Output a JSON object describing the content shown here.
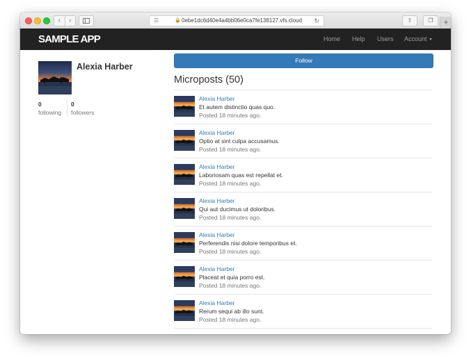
{
  "browser": {
    "url": "0ebe1dc6d40e4a4bb06e0ca7fe138127.vfs.cloud"
  },
  "header": {
    "logo": "SAMPLE APP",
    "nav": {
      "home": "Home",
      "help": "Help",
      "users": "Users",
      "account": "Account"
    }
  },
  "profile": {
    "name": "Alexia Harber",
    "following_count": "0",
    "following_label": "following",
    "followers_count": "0",
    "followers_label": "followers"
  },
  "follow_button": "Follow",
  "microposts": {
    "heading": "Microposts (50)",
    "items": [
      {
        "author": "Alexia Harber",
        "content": "Et autem distinctio quas quo.",
        "timestamp": "Posted 18 minutes ago."
      },
      {
        "author": "Alexia Harber",
        "content": "Optio at sint culpa accusamus.",
        "timestamp": "Posted 18 minutes ago."
      },
      {
        "author": "Alexia Harber",
        "content": "Laboriosam quas est repellat et.",
        "timestamp": "Posted 18 minutes ago."
      },
      {
        "author": "Alexia Harber",
        "content": "Qui aut ducimus ut doloribus.",
        "timestamp": "Posted 18 minutes ago."
      },
      {
        "author": "Alexia Harber",
        "content": "Perferendis nisi dolore temporibus et.",
        "timestamp": "Posted 18 minutes ago."
      },
      {
        "author": "Alexia Harber",
        "content": "Placeat et quia porro est.",
        "timestamp": "Posted 18 minutes ago."
      },
      {
        "author": "Alexia Harber",
        "content": "Rerum sequi ab illo sunt.",
        "timestamp": "Posted 18 minutes ago."
      }
    ]
  },
  "colors": {
    "navbar": "#222222",
    "link": "#337ab7",
    "button": "#337ab7"
  }
}
